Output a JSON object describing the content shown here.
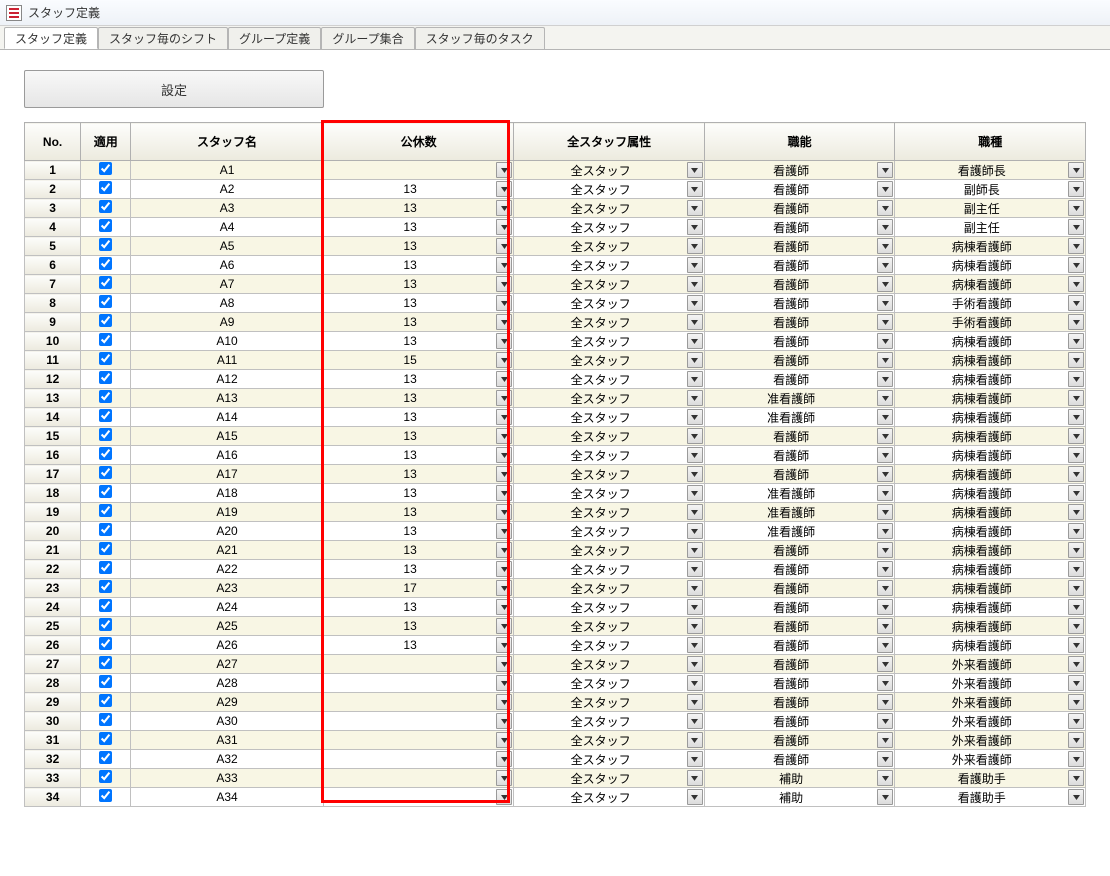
{
  "window": {
    "title": "スタッフ定義"
  },
  "tabs": [
    {
      "label": "スタッフ定義",
      "active": true
    },
    {
      "label": "スタッフ毎のシフト",
      "active": false
    },
    {
      "label": "グループ定義",
      "active": false
    },
    {
      "label": "グループ集合",
      "active": false
    },
    {
      "label": "スタッフ毎のタスク",
      "active": false
    }
  ],
  "toolbar": {
    "settings_label": "設定"
  },
  "columns": {
    "no": "No.",
    "apply": "適用",
    "name": "スタッフ名",
    "holidays": "公休数",
    "attr": "全スタッフ属性",
    "ability": "職能",
    "type": "職種"
  },
  "rows": [
    {
      "no": 1,
      "apply": true,
      "name": "A1",
      "holidays": "",
      "attr": "全スタッフ",
      "ability": "看護師",
      "type": "看護師長"
    },
    {
      "no": 2,
      "apply": true,
      "name": "A2",
      "holidays": "13",
      "attr": "全スタッフ",
      "ability": "看護師",
      "type": "副師長"
    },
    {
      "no": 3,
      "apply": true,
      "name": "A3",
      "holidays": "13",
      "attr": "全スタッフ",
      "ability": "看護師",
      "type": "副主任"
    },
    {
      "no": 4,
      "apply": true,
      "name": "A4",
      "holidays": "13",
      "attr": "全スタッフ",
      "ability": "看護師",
      "type": "副主任"
    },
    {
      "no": 5,
      "apply": true,
      "name": "A5",
      "holidays": "13",
      "attr": "全スタッフ",
      "ability": "看護師",
      "type": "病棟看護師"
    },
    {
      "no": 6,
      "apply": true,
      "name": "A6",
      "holidays": "13",
      "attr": "全スタッフ",
      "ability": "看護師",
      "type": "病棟看護師"
    },
    {
      "no": 7,
      "apply": true,
      "name": "A7",
      "holidays": "13",
      "attr": "全スタッフ",
      "ability": "看護師",
      "type": "病棟看護師"
    },
    {
      "no": 8,
      "apply": true,
      "name": "A8",
      "holidays": "13",
      "attr": "全スタッフ",
      "ability": "看護師",
      "type": "手術看護師"
    },
    {
      "no": 9,
      "apply": true,
      "name": "A9",
      "holidays": "13",
      "attr": "全スタッフ",
      "ability": "看護師",
      "type": "手術看護師"
    },
    {
      "no": 10,
      "apply": true,
      "name": "A10",
      "holidays": "13",
      "attr": "全スタッフ",
      "ability": "看護師",
      "type": "病棟看護師"
    },
    {
      "no": 11,
      "apply": true,
      "name": "A11",
      "holidays": "15",
      "attr": "全スタッフ",
      "ability": "看護師",
      "type": "病棟看護師"
    },
    {
      "no": 12,
      "apply": true,
      "name": "A12",
      "holidays": "13",
      "attr": "全スタッフ",
      "ability": "看護師",
      "type": "病棟看護師"
    },
    {
      "no": 13,
      "apply": true,
      "name": "A13",
      "holidays": "13",
      "attr": "全スタッフ",
      "ability": "准看護師",
      "type": "病棟看護師"
    },
    {
      "no": 14,
      "apply": true,
      "name": "A14",
      "holidays": "13",
      "attr": "全スタッフ",
      "ability": "准看護師",
      "type": "病棟看護師"
    },
    {
      "no": 15,
      "apply": true,
      "name": "A15",
      "holidays": "13",
      "attr": "全スタッフ",
      "ability": "看護師",
      "type": "病棟看護師"
    },
    {
      "no": 16,
      "apply": true,
      "name": "A16",
      "holidays": "13",
      "attr": "全スタッフ",
      "ability": "看護師",
      "type": "病棟看護師"
    },
    {
      "no": 17,
      "apply": true,
      "name": "A17",
      "holidays": "13",
      "attr": "全スタッフ",
      "ability": "看護師",
      "type": "病棟看護師"
    },
    {
      "no": 18,
      "apply": true,
      "name": "A18",
      "holidays": "13",
      "attr": "全スタッフ",
      "ability": "准看護師",
      "type": "病棟看護師"
    },
    {
      "no": 19,
      "apply": true,
      "name": "A19",
      "holidays": "13",
      "attr": "全スタッフ",
      "ability": "准看護師",
      "type": "病棟看護師"
    },
    {
      "no": 20,
      "apply": true,
      "name": "A20",
      "holidays": "13",
      "attr": "全スタッフ",
      "ability": "准看護師",
      "type": "病棟看護師"
    },
    {
      "no": 21,
      "apply": true,
      "name": "A21",
      "holidays": "13",
      "attr": "全スタッフ",
      "ability": "看護師",
      "type": "病棟看護師"
    },
    {
      "no": 22,
      "apply": true,
      "name": "A22",
      "holidays": "13",
      "attr": "全スタッフ",
      "ability": "看護師",
      "type": "病棟看護師"
    },
    {
      "no": 23,
      "apply": true,
      "name": "A23",
      "holidays": "17",
      "attr": "全スタッフ",
      "ability": "看護師",
      "type": "病棟看護師"
    },
    {
      "no": 24,
      "apply": true,
      "name": "A24",
      "holidays": "13",
      "attr": "全スタッフ",
      "ability": "看護師",
      "type": "病棟看護師"
    },
    {
      "no": 25,
      "apply": true,
      "name": "A25",
      "holidays": "13",
      "attr": "全スタッフ",
      "ability": "看護師",
      "type": "病棟看護師"
    },
    {
      "no": 26,
      "apply": true,
      "name": "A26",
      "holidays": "13",
      "attr": "全スタッフ",
      "ability": "看護師",
      "type": "病棟看護師"
    },
    {
      "no": 27,
      "apply": true,
      "name": "A27",
      "holidays": "",
      "attr": "全スタッフ",
      "ability": "看護師",
      "type": "外来看護師"
    },
    {
      "no": 28,
      "apply": true,
      "name": "A28",
      "holidays": "",
      "attr": "全スタッフ",
      "ability": "看護師",
      "type": "外来看護師"
    },
    {
      "no": 29,
      "apply": true,
      "name": "A29",
      "holidays": "",
      "attr": "全スタッフ",
      "ability": "看護師",
      "type": "外来看護師"
    },
    {
      "no": 30,
      "apply": true,
      "name": "A30",
      "holidays": "",
      "attr": "全スタッフ",
      "ability": "看護師",
      "type": "外来看護師"
    },
    {
      "no": 31,
      "apply": true,
      "name": "A31",
      "holidays": "",
      "attr": "全スタッフ",
      "ability": "看護師",
      "type": "外来看護師"
    },
    {
      "no": 32,
      "apply": true,
      "name": "A32",
      "holidays": "",
      "attr": "全スタッフ",
      "ability": "看護師",
      "type": "外来看護師"
    },
    {
      "no": 33,
      "apply": true,
      "name": "A33",
      "holidays": "",
      "attr": "全スタッフ",
      "ability": "補助",
      "type": "看護助手"
    },
    {
      "no": 34,
      "apply": true,
      "name": "A34",
      "holidays": "",
      "attr": "全スタッフ",
      "ability": "補助",
      "type": "看護助手"
    }
  ],
  "highlight_column": "holidays"
}
